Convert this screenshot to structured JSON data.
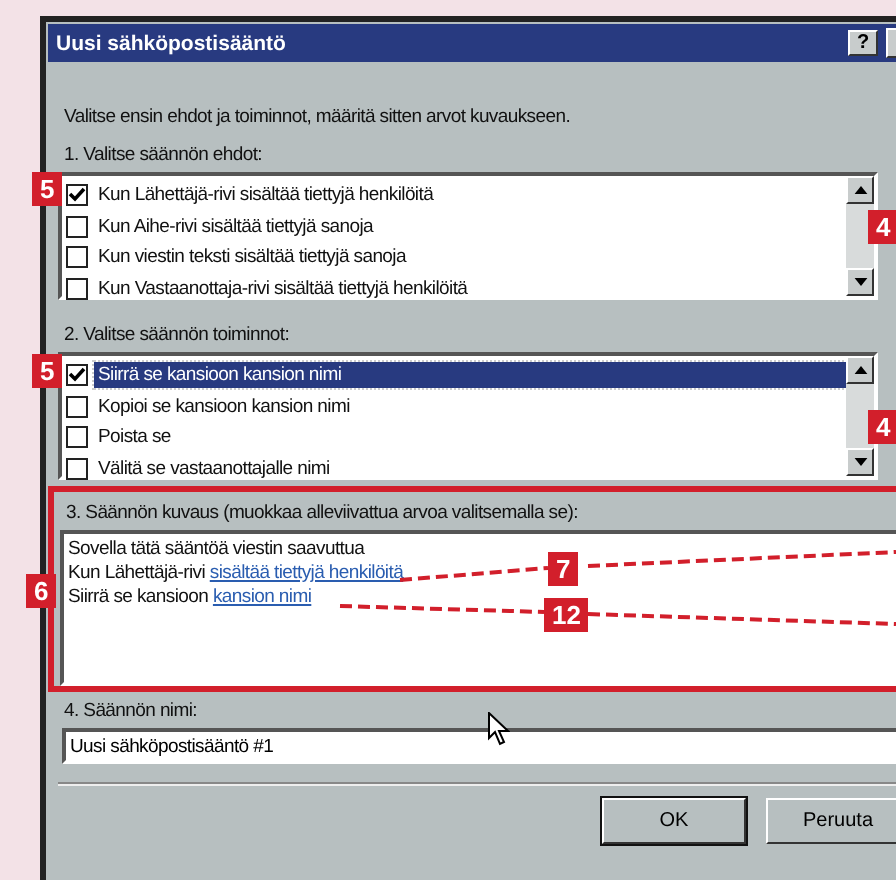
{
  "window": {
    "title": "Uusi sähköpostisääntö",
    "help_button": "?"
  },
  "intro": "Valitse ensin ehdot ja toiminnot, määritä sitten arvot kuvaukseen.",
  "conditions": {
    "label": "1. Valitse säännön ehdot:",
    "items": [
      {
        "label": "Kun Lähettäjä-rivi sisältää tiettyjä henkilöitä",
        "checked": true,
        "selected": false
      },
      {
        "label": "Kun Aihe-rivi sisältää tiettyjä sanoja",
        "checked": false,
        "selected": false
      },
      {
        "label": "Kun viestin teksti sisältää tiettyjä sanoja",
        "checked": false,
        "selected": false
      },
      {
        "label": "Kun Vastaanottaja-rivi sisältää tiettyjä henkilöitä",
        "checked": false,
        "selected": false
      }
    ]
  },
  "actions": {
    "label": "2. Valitse säännön toiminnot:",
    "items": [
      {
        "label": "Siirrä se kansioon kansion nimi",
        "checked": true,
        "selected": true
      },
      {
        "label": "Kopioi se kansioon kansion nimi",
        "checked": false,
        "selected": false
      },
      {
        "label": "Poista se",
        "checked": false,
        "selected": false
      },
      {
        "label": "Välitä se vastaanottajalle nimi",
        "checked": false,
        "selected": false
      }
    ]
  },
  "description": {
    "label": "3. Säännön kuvaus (muokkaa alleviivattua arvoa valitsemalla se):",
    "lines": [
      {
        "text": "Sovella tätä sääntöä viestin saavuttua"
      },
      {
        "text": "Kun Lähettäjä-rivi",
        "link": "sisältää tiettyjä henkilöitä"
      },
      {
        "text": "Siirrä se kansioon",
        "link": "kansion nimi"
      }
    ]
  },
  "rule_name": {
    "label": "4. Säännön nimi:",
    "value": "Uusi sähköpostisääntö #1"
  },
  "buttons": [
    {
      "label": "OK",
      "default": true
    },
    {
      "label": "Peruuta",
      "default": false
    }
  ],
  "callouts": [
    "5",
    "4",
    "5",
    "4",
    "6",
    "7",
    "12"
  ]
}
